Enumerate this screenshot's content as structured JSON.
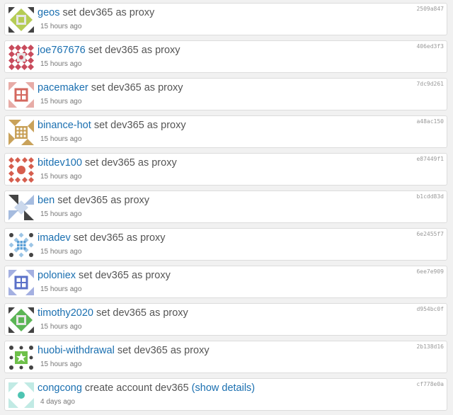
{
  "feed": {
    "items": [
      {
        "user": "geos",
        "action": "set dev365 as proxy",
        "time": "15 hours ago",
        "hash": "2509a847",
        "color": "#b5cc55",
        "shape": "diamond-square"
      },
      {
        "user": "joe767676",
        "action": "set dev365 as proxy",
        "time": "15 hours ago",
        "hash": "406ed3f3",
        "color": "#c84b5c",
        "shape": "diamond-grid"
      },
      {
        "user": "pacemaker",
        "action": "set dev365 as proxy",
        "time": "15 hours ago",
        "hash": "7dc9d261",
        "color": "#d4685f",
        "shape": "window"
      },
      {
        "user": "binance-hot",
        "action": "set dev365 as proxy",
        "time": "15 hours ago",
        "hash": "a48ac150",
        "color": "#c9a25a",
        "shape": "dots-square"
      },
      {
        "user": "bitdev100",
        "action": "set dev365 as proxy",
        "time": "15 hours ago",
        "hash": "e87449f1",
        "color": "#d65e4e",
        "shape": "diamond-circle"
      },
      {
        "user": "ben",
        "action": "set dev365 as proxy",
        "time": "15 hours ago",
        "hash": "b1cdd83d",
        "color": "#6b8fc9",
        "shape": "pinwheel"
      },
      {
        "user": "imadev",
        "action": "set dev365 as proxy",
        "time": "15 hours ago",
        "hash": "6e2455f7",
        "color": "#5a9fd6",
        "shape": "grid-dots"
      },
      {
        "user": "poloniex",
        "action": "set dev365 as proxy",
        "time": "15 hours ago",
        "hash": "6ee7e909",
        "color": "#5a70c8",
        "shape": "window"
      },
      {
        "user": "timothy2020",
        "action": "set dev365 as proxy",
        "time": "15 hours ago",
        "hash": "d954bc0f",
        "color": "#5bb555",
        "shape": "diamond-square"
      },
      {
        "user": "huobi-withdrawal",
        "action": "set dev365 as proxy",
        "time": "15 hours ago",
        "hash": "2b138d16",
        "color": "#6ec04a",
        "shape": "star-square"
      },
      {
        "user": "congcong",
        "action": "create account dev365",
        "time": "4 days ago",
        "hash": "cf778e0a",
        "color": "#4ec4b2",
        "shape": "circle",
        "details": "(show details)"
      }
    ]
  }
}
